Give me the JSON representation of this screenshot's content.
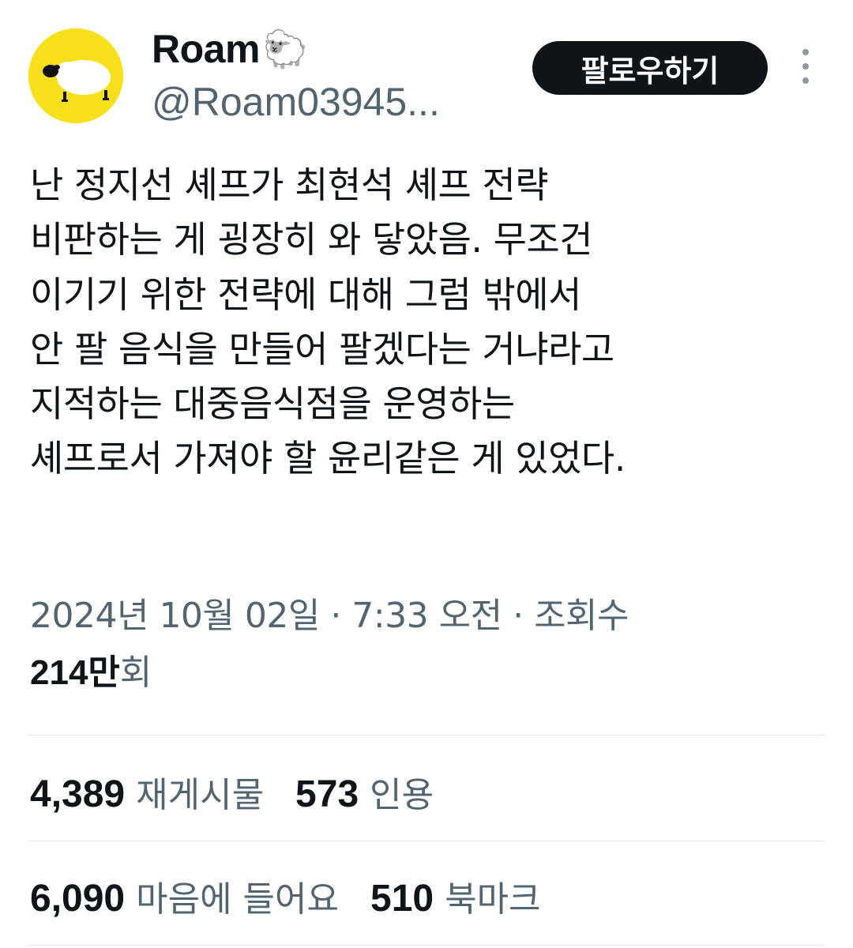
{
  "author": {
    "display_name": "Roam",
    "name_emoji": "🐑",
    "handle": "@Roam03945...",
    "avatar_icon": "sheep-avatar-icon",
    "avatar_color": "#f8df1b"
  },
  "actions": {
    "follow_label": "팔로우하기",
    "more_icon": "vertical-dots-icon"
  },
  "tweet": {
    "lines": [
      "난 정지선 셰프가 최현석 셰프 전략",
      "비판하는 게 굉장히 와 닿았음. 무조건",
      "이기기 위한 전략에 대해 그럼 밖에서",
      "안 팔 음식을 만들어 팔겠다는 거냐라고",
      "지적하는 대중음식점을 운영하는",
      "셰프로서 가져야 할 윤리같은 게 있었다."
    ]
  },
  "meta": {
    "date": "2024년 10월 02일",
    "separator": " · ",
    "time": "7:33 오전",
    "views_prefix": "조회수",
    "views_count": "214만",
    "views_suffix": "회"
  },
  "stats": {
    "reposts_count": "4,389",
    "reposts_label": "재게시물",
    "quotes_count": "573",
    "quotes_label": "인용",
    "likes_count": "6,090",
    "likes_label": "마음에 들어요",
    "bookmarks_count": "510",
    "bookmarks_label": "북마크"
  },
  "colors": {
    "primary_text": "#0f1419",
    "secondary_text": "#536471",
    "button_bg": "#0f1419",
    "divider": "#e1e6ea"
  }
}
